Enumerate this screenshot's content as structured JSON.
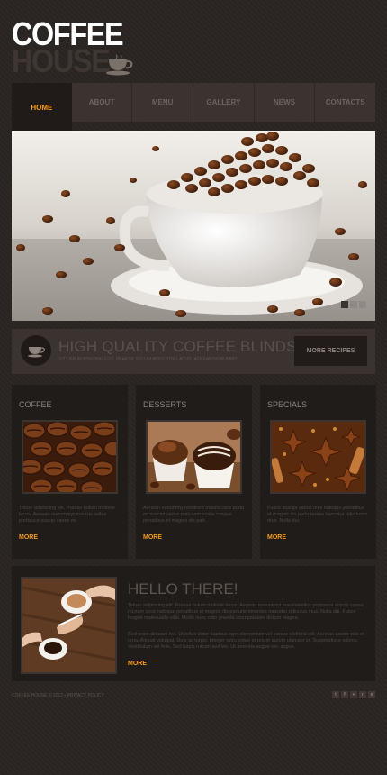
{
  "logo": {
    "line1": "COFFEE",
    "line2": "HOUSE"
  },
  "nav": {
    "items": [
      "HOME",
      "ABOUT",
      "MENU",
      "GALLERY",
      "NEWS",
      "CONTACTS"
    ],
    "active": "HOME"
  },
  "banner": {
    "title": "HIGH QUALITY COFFEE BLINDS",
    "subtitle": "SIT UER ADIPISCING ELIT. PRAESE SULUM MOLESTIE LACUS. AENEAN NONUMMY",
    "button": "MORE RECIPES"
  },
  "columns": [
    {
      "title": "COFFEE",
      "text": "Totuer adipiscing elit. Praese bulum molistie lacus. Aenean nonummyt maurris sellus porttauce suscip vanes mi.",
      "more": "MORE"
    },
    {
      "title": "DESSERTS",
      "text": "Aenean nonummy hendrerit mauris.cere porta ac suscipi varius mini nam scelis cusque penatibus et magnis dis part.",
      "more": "MORE"
    },
    {
      "title": "SPECIALS",
      "text": "Fusce suscipi varius mini natoque penatibus et magnis dis parturientes nascetur ridic lusce ntus. Nulla dui.",
      "more": "MORE"
    }
  ],
  "hello": {
    "title": "HELLO THERE!",
    "p1": "Tetuer adipiscing elit. Praese bulum molistie lacus. Aenean nonummyt mauriseiellus porttauce suscip vanes mi.nam coce natoque penatibus et magnis dis parturientmontes nascetur ridiculus mus. Nulla dui. Fusce feugiat malesuada odio. Morbi nunc odio gravida aturnpatatam dictum magna.",
    "p2": "Sed orsm aliquam leo. Ut tellus dolor dapibus eget elementum vel cursus eleifend elit. Aenean auctor wisi et urna. Aliquat volutpat. Duis ac turpis. Integer rutru ontae et rerum aurum ulamaor in. Suspendisse volenu. Vestibulum vel felis. Sed turpis rutrum sed leo. Ut amentia augue sec augue.",
    "more": "MORE"
  },
  "footer": {
    "text": "COFFEE HOUSE © 2012 • PRIVACY POLICY"
  },
  "social": [
    "twitter-icon",
    "facebook-icon",
    "plus-icon",
    "rss-icon",
    "circle-icon"
  ],
  "colors": {
    "accent": "#f39c1c",
    "background": "#2a2522",
    "panel": "#201c1a"
  }
}
